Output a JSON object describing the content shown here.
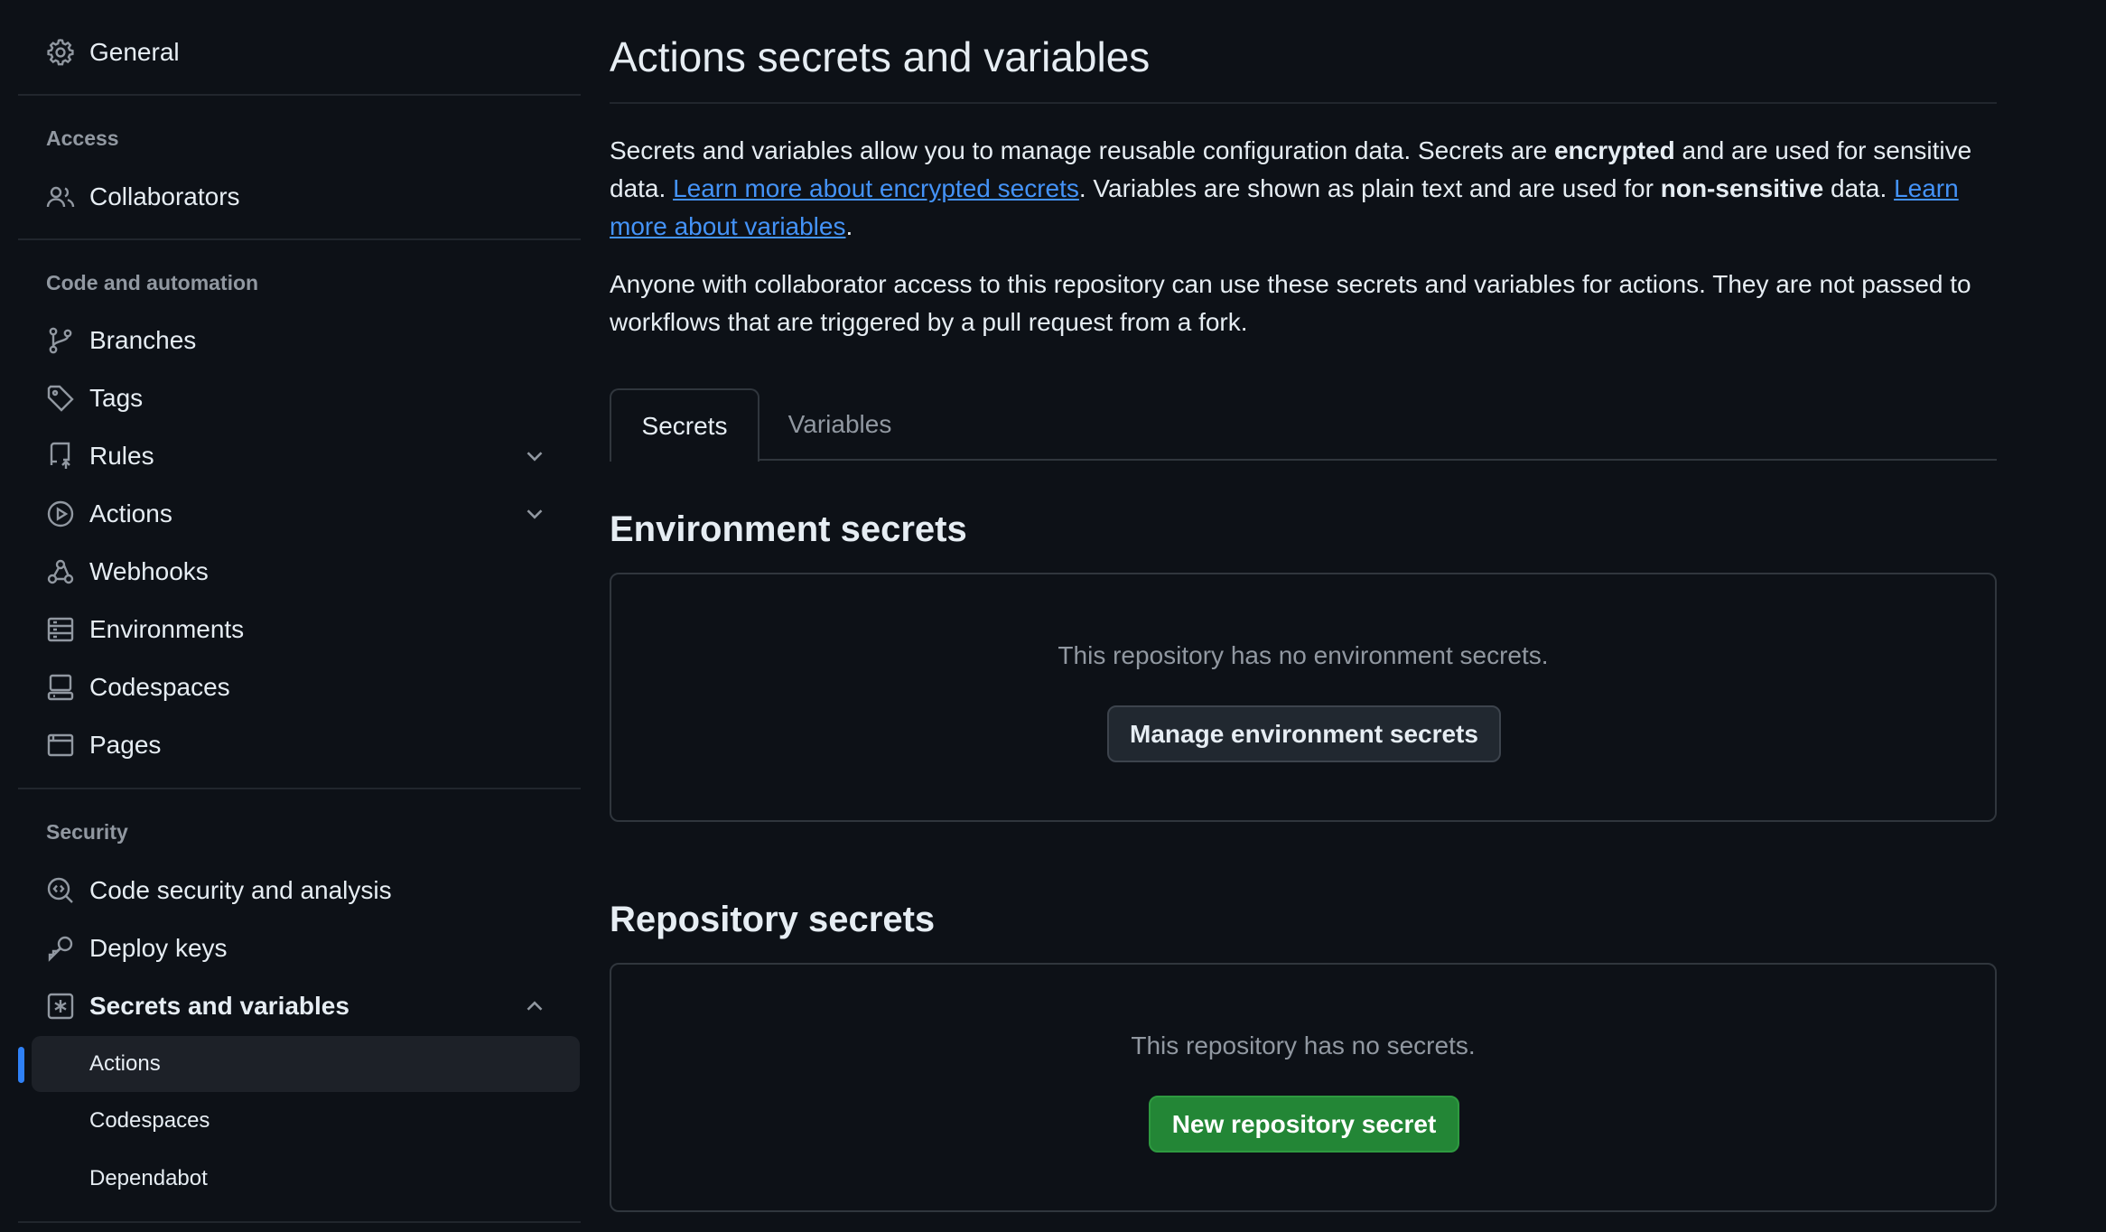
{
  "sidebar": {
    "general": "General",
    "access": {
      "title": "Access",
      "collaborators": "Collaborators"
    },
    "code_automation": {
      "title": "Code and automation",
      "items": [
        "Branches",
        "Tags",
        "Rules",
        "Actions",
        "Webhooks",
        "Environments",
        "Codespaces",
        "Pages"
      ]
    },
    "security": {
      "title": "Security",
      "code_security": "Code security and analysis",
      "deploy_keys": "Deploy keys",
      "secrets_variables": "Secrets and variables",
      "sub_items": [
        "Actions",
        "Codespaces",
        "Dependabot"
      ],
      "active_sub_item": "Actions"
    }
  },
  "main": {
    "title": "Actions secrets and variables",
    "intro": {
      "p1_a": "Secrets and variables allow you to manage reusable configuration data. Secrets are ",
      "p1_b": "encrypted",
      "p1_c": " and are used for sensitive data. ",
      "link_secrets": "Learn more about encrypted secrets",
      "p1_d": ". Variables are shown as plain text and are used for ",
      "p1_e": "non-sensitive",
      "p1_f": " data. ",
      "link_variables": "Learn more about variables",
      "p1_g": ".",
      "p2": "Anyone with collaborator access to this repository can use these secrets and variables for actions. They are not passed to workflows that are triggered by a pull request from a fork."
    },
    "tabs": {
      "secrets": "Secrets",
      "variables": "Variables",
      "selected": "Secrets"
    },
    "environment_secrets": {
      "heading": "Environment secrets",
      "empty_text": "This repository has no environment secrets.",
      "button": "Manage environment secrets"
    },
    "repository_secrets": {
      "heading": "Repository secrets",
      "empty_text": "This repository has no secrets.",
      "button": "New repository secret"
    }
  },
  "colors": {
    "background": "#0d1117",
    "link": "#4493f8",
    "primary_button": "#238636",
    "active_indicator": "#2f81f7"
  }
}
